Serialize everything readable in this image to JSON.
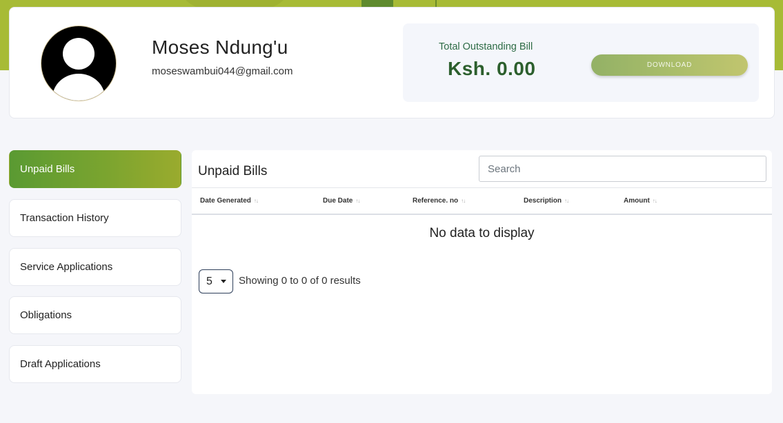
{
  "profile": {
    "name": "Moses Ndung'u",
    "email": "moseswambui044@gmail.com"
  },
  "bill": {
    "label": "Total Outstanding Bill",
    "amount": "Ksh. 0.00",
    "download_label": "DOWNLOAD"
  },
  "sidebar": {
    "items": [
      {
        "label": "Unpaid Bills",
        "active": true
      },
      {
        "label": "Transaction History",
        "active": false
      },
      {
        "label": "Service Applications",
        "active": false
      },
      {
        "label": "Obligations",
        "active": false
      },
      {
        "label": "Draft Applications",
        "active": false
      }
    ]
  },
  "main": {
    "title": "Unpaid Bills",
    "search": {
      "placeholder": "Search",
      "value": ""
    },
    "columns": [
      "Date Generated",
      "Due Date",
      "Reference. no",
      "Description",
      "Amount"
    ],
    "sort_glyph": "↑↓",
    "empty_message": "No data to display",
    "page_size": "5",
    "showing": "Showing 0 to 0 of 0 results"
  },
  "colors": {
    "accent": "#a7bb36",
    "active_nav": "#7aa42f",
    "amount_text": "#2c5f2d"
  }
}
